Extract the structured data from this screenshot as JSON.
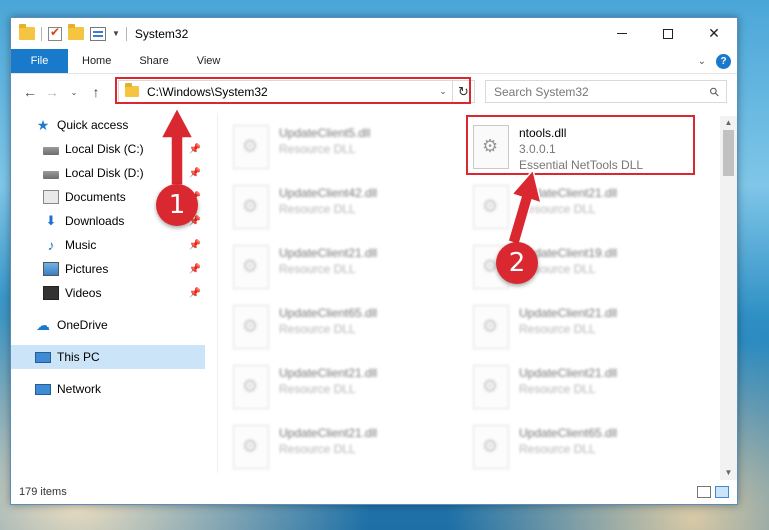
{
  "window": {
    "title": "System32",
    "status_items": "179 items"
  },
  "ribbon": {
    "tabs": [
      "File",
      "Home",
      "Share",
      "View"
    ]
  },
  "address": {
    "path": "C:\\Windows\\System32",
    "search_placeholder": "Search System32"
  },
  "sidebar": {
    "items": [
      {
        "label": "Quick access",
        "icon": "star-icon",
        "pinned": false
      },
      {
        "label": "Local Disk (C:)",
        "icon": "drive-icon",
        "pinned": true
      },
      {
        "label": "Local Disk (D:)",
        "icon": "drive-icon",
        "pinned": true
      },
      {
        "label": "Documents",
        "icon": "documents-icon",
        "pinned": true
      },
      {
        "label": "Downloads",
        "icon": "download-icon",
        "pinned": true
      },
      {
        "label": "Music",
        "icon": "music-icon",
        "pinned": true
      },
      {
        "label": "Pictures",
        "icon": "pictures-icon",
        "pinned": true
      },
      {
        "label": "Videos",
        "icon": "videos-icon",
        "pinned": true
      },
      {
        "label": "OneDrive",
        "icon": "cloud-icon",
        "pinned": false
      },
      {
        "label": "This PC",
        "icon": "computer-icon",
        "pinned": false,
        "selected": true
      },
      {
        "label": "Network",
        "icon": "network-icon",
        "pinned": false
      }
    ]
  },
  "files": {
    "highlighted": {
      "name": "ntools.dll",
      "version": "3.0.0.1",
      "description": "Essential NetTools DLL"
    },
    "left_column": [
      {
        "name": "UpdateClient5.dll",
        "description": "Resource DLL"
      },
      {
        "name": "UpdateClient42.dll",
        "description": "Resource DLL"
      },
      {
        "name": "UpdateClient21.dll",
        "description": "Resource DLL"
      },
      {
        "name": "UpdateClient65.dll",
        "description": "Resource DLL"
      },
      {
        "name": "UpdateClient21.dll",
        "description": "Resource DLL"
      },
      {
        "name": "UpdateClient21.dll",
        "description": "Resource DLL"
      }
    ],
    "right_column": [
      {
        "name": "UpdateClient21.dll",
        "description": "Resource DLL"
      },
      {
        "name": "UpdateClient19.dll",
        "description": "Resource DLL"
      },
      {
        "name": "UpdateClient21.dll",
        "description": "Resource DLL"
      },
      {
        "name": "UpdateClient21.dll",
        "description": "Resource DLL"
      },
      {
        "name": "UpdateClient65.dll",
        "description": "Resource DLL"
      }
    ]
  },
  "callouts": [
    "1",
    "2"
  ],
  "colors": {
    "accent": "#1979ca",
    "highlight_box": "#d9282f",
    "selected_nav": "#cce4f7"
  }
}
